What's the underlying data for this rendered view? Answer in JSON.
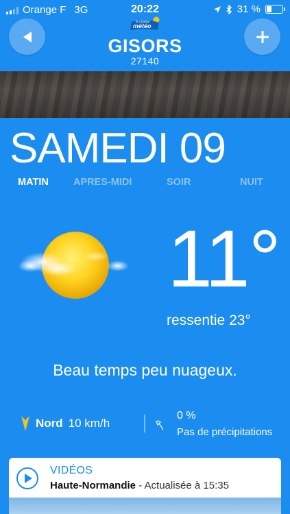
{
  "status_bar": {
    "carrier": "Orange F",
    "network": "3G",
    "time": "20:22",
    "battery": "31 %"
  },
  "header": {
    "logo_small": "la chaîne",
    "logo_main": "météo",
    "city": "GISORS",
    "postal_code": "27140",
    "back_icon": "back-arrow-icon",
    "add_icon": "plus-icon"
  },
  "forecast": {
    "day": "SAMEDI 09",
    "tabs": [
      {
        "label": "MATIN",
        "active": true
      },
      {
        "label": "APRES-MIDI",
        "active": false
      },
      {
        "label": "SOIR",
        "active": false
      },
      {
        "label": "NUIT",
        "active": false
      }
    ],
    "icon": "sun-with-cloud-icon",
    "temperature": "11°",
    "feels_label": "ressentie",
    "feels_value": "23°",
    "description": "Beau temps peu nuageux.",
    "wind": {
      "direction": "Nord",
      "speed": "10 km/h"
    },
    "precip": {
      "percent": "0 %",
      "text": "Pas de précipitations"
    }
  },
  "videos": {
    "label": "VIDÉOS",
    "region": "Haute-Normandie",
    "updated": "- Actualisée à 15:35"
  },
  "colors": {
    "background": "#1b8cf0",
    "accent_yellow": "#f6c21c"
  }
}
